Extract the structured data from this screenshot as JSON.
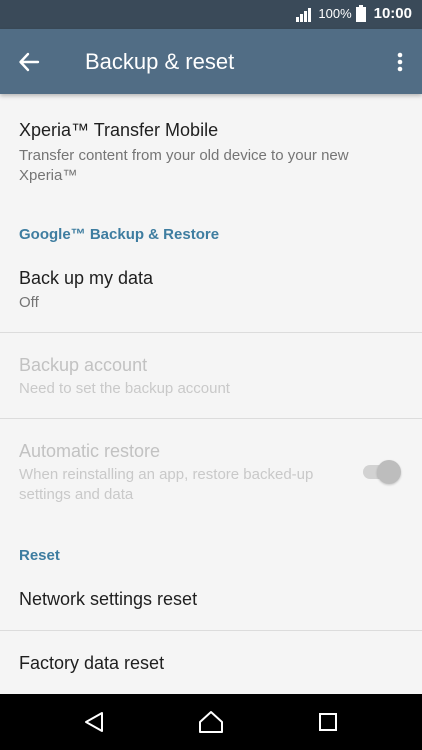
{
  "status_bar": {
    "battery": "100%",
    "time": "10:00"
  },
  "app_bar": {
    "title": "Backup & reset"
  },
  "list": {
    "transfer": {
      "title": "Xperia™ Transfer Mobile",
      "subtitle": "Transfer content from your old device to your new Xperia™"
    },
    "google_header": "Google™ Backup & Restore",
    "backup_data": {
      "title": "Back up my data",
      "subtitle": "Off"
    },
    "backup_account": {
      "title": "Backup account",
      "subtitle": "Need to set the backup account"
    },
    "auto_restore": {
      "title": "Automatic restore",
      "subtitle": "When reinstalling an app, restore backed-up settings and data",
      "enabled": false
    },
    "reset_header": "Reset",
    "network_reset": {
      "title": "Network settings reset"
    },
    "factory_reset": {
      "title": "Factory data reset"
    }
  },
  "colors": {
    "status_bar": "#3a4a59",
    "app_bar": "#516d85",
    "accent": "#3e7da0",
    "background": "#f5f5f5"
  },
  "icons": {
    "back": "arrow-left-icon",
    "more": "more-vert-icon",
    "nav_back": "triangle-back-icon",
    "nav_home": "home-icon",
    "nav_recents": "square-recents-icon"
  }
}
